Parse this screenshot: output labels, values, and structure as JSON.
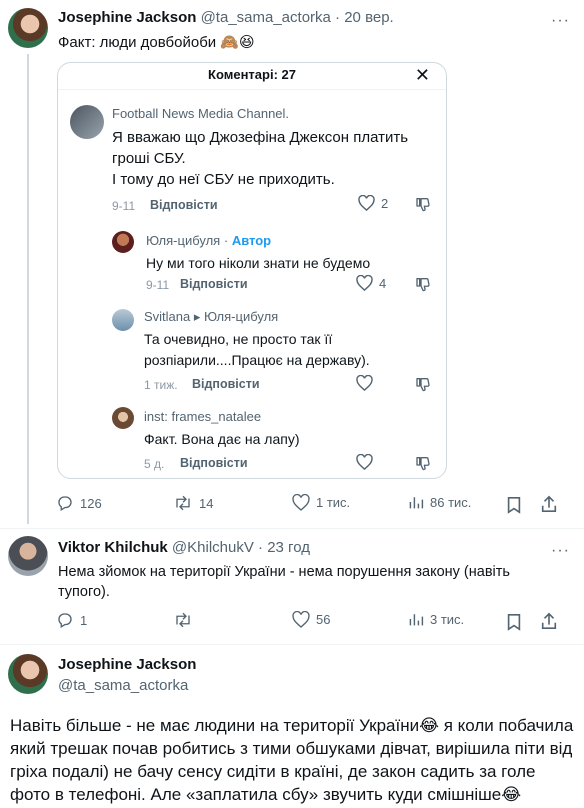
{
  "tweet1": {
    "name": "Josephine Jackson",
    "handle": "@ta_sama_actorka",
    "dot": "·",
    "time": "20 вер.",
    "more": "···",
    "text": "Факт: люди довбойоби 🙈😆"
  },
  "card": {
    "title": "Коментарі: 27",
    "close": "✕",
    "comments": [
      {
        "author": "Football News Media Channel.",
        "lines": [
          "Я вважаю що Джозефіна Джексон платить",
          "гроші СБУ.",
          "І тому до неї СБУ не приходить."
        ],
        "time": "9-11",
        "reply": "Відповісти",
        "likes": "2"
      },
      {
        "author": "Юля-цибуля",
        "badge": "Автор",
        "lines": [
          "Ну ми того ніколи знати не будемо"
        ],
        "time": "9-11",
        "reply": "Відповісти",
        "likes": "4"
      },
      {
        "author": "Svitlana ▸ Юля-цибуля",
        "lines": [
          "Та очевидно, не просто так її",
          "розпіарили....Працює на державу)."
        ],
        "time": "1 тиж.",
        "reply": "Відповісти"
      },
      {
        "author": "inst: frames_natalee",
        "lines": [
          "Факт. Вона дає на лапу)"
        ],
        "time": "5 д.",
        "reply": "Відповісти"
      }
    ]
  },
  "tweet1_actions": {
    "replies": "126",
    "retweets": "14",
    "likes": "1 тис.",
    "views": "86 тис."
  },
  "tweet2": {
    "name": "Viktor Khilchuk",
    "handle": "@KhilchukV",
    "dot": "·",
    "time": "23 год",
    "more": "···",
    "line1": "Нема зйомок на території України - нема порушення закону (навіть",
    "line2": "тупого).",
    "actions": {
      "replies": "1",
      "retweets": "",
      "likes": "56",
      "views": "3 тис."
    }
  },
  "tweet3": {
    "name": "Josephine Jackson",
    "handle": "@ta_sama_actorka",
    "text": "Навіть більше - не має людини на території України😂 я коли побачила який трешак почав робитись з тими обшуками дівчат, вирішила піти від гріха подалі) не бачу сенсу сидіти в країні, де закон садить за голе фото в телефоні. Але «заплатила сбу» звучить куди смішніше😂"
  },
  "colors": {
    "accent": "#1d9bf0",
    "muted": "#536471",
    "border": "#cfd9de"
  }
}
